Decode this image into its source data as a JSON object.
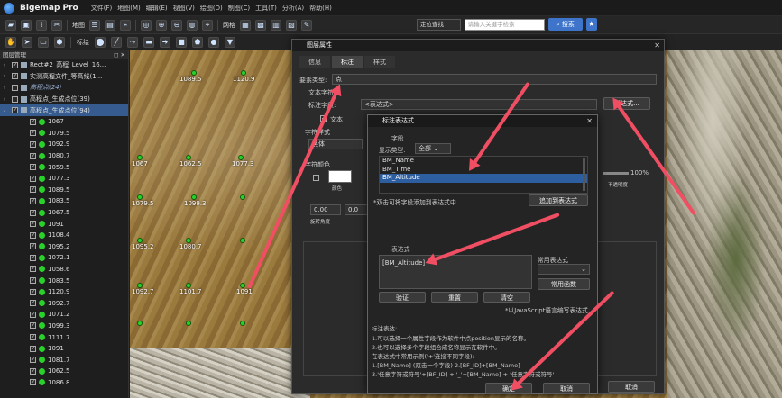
{
  "app": {
    "title": "Bigemap Pro",
    "menu": [
      "文件(F)",
      "地图(M)",
      "编辑(E)",
      "视图(V)",
      "绘图(D)",
      "制图(C)",
      "工具(T)",
      "分析(A)",
      "帮助(H)"
    ]
  },
  "toolbar": {
    "map_label": "地图",
    "grid_label": "网格",
    "measure_label": "标绘",
    "search_mode": "定位查找",
    "search_placeholder": "请输入关键字检索",
    "search_button": "搜索"
  },
  "layer_panel": {
    "header": "图层管理",
    "items": [
      {
        "label": "Rect#2_高程_Level_16...",
        "selected": false,
        "italic": false
      },
      {
        "label": "实测高程文件_等高线(1...",
        "selected": false,
        "italic": false
      },
      {
        "label": "高程点(24)",
        "selected": false,
        "italic": true
      },
      {
        "label": "高程点_生成点位(39)",
        "selected": false,
        "italic": false
      },
      {
        "label": "高程点_生成点位(94)",
        "selected": true,
        "italic": false
      }
    ],
    "values": [
      "1067",
      "1079.5",
      "1092.9",
      "1080.7",
      "1059.5",
      "1077.3",
      "1089.5",
      "1083.5",
      "1067.5",
      "1091",
      "1108.4",
      "1095.2",
      "1072.1",
      "1058.6",
      "1083.5",
      "1120.9",
      "1092.7",
      "1071.2",
      "1099.3",
      "1111.7",
      "1091",
      "1081.7",
      "1062.5",
      "1086.8"
    ]
  },
  "map_labels": [
    "1089.5",
    "1120.9",
    "1067",
    "1062.5",
    "1077.3",
    "1079.5",
    "1099.3",
    "1095.2",
    "1080.7",
    "1092.7",
    "1101.7",
    "1091"
  ],
  "layer_props": {
    "title": "图层属性",
    "tabs": [
      "信息",
      "标注",
      "样式"
    ],
    "element_type_label": "要素类型:",
    "element_type_value": "点",
    "section_text_string": "文本字符串",
    "label_field_label": "标注字段:",
    "label_field_value": "<表达式>",
    "expression_button": "表达式...",
    "text_checkbox": "文本",
    "section_font_style": "字符样式",
    "font_value": "黑体",
    "font_color_label": "字符颜色",
    "opacity_value": "100%",
    "opacity_caption": "不透明度",
    "color_caption": "颜色",
    "rotation_value": "0.00",
    "rotation_caption": "旋转角度",
    "offset_value": "0.0",
    "ok_button": "确定",
    "cancel_button": "取消"
  },
  "expression_dialog": {
    "title": "标注表达式",
    "section_fields": "字段",
    "display_type_label": "显示类型:",
    "display_type_value": "全部",
    "fields": [
      "BM_Name",
      "BM_Time",
      "BM_Altitude"
    ],
    "selected_field": "BM_Altitude",
    "double_click_hint": "*双击可将字段添加到表达式中",
    "add_button": "追加到表达式",
    "section_expression": "表达式",
    "expression_value": "[BM_Altitude]",
    "common_expr_label": "常用表达式",
    "common_func_button": "常用函数",
    "verify_button": "验证",
    "reset_button": "重置",
    "clear_button": "清空",
    "js_hint": "*以JavaScript语言编写表达式",
    "help_title": "标注表达:",
    "help_lines": [
      "1.可以选择一个属性字段作为软件中点position显示的名称。",
      "2.也可以选择多个字段组合成名称显示在软件中。",
      "在表达式中常用示例('+'连接不同字段):",
      "1.[BM_Name]  (双击一个字段)        2.[BF_ID]+[BM_Name]",
      "3.'任意字符或符号'+[BF_ID] + '_'+[BM_Name] + '任意字符或符号'"
    ],
    "ok_button": "确定",
    "cancel_button": "取消"
  },
  "colors": {
    "accent": "#3e74c9",
    "arrow": "#f04f63",
    "selection": "#2d5fa0",
    "point": "#2bd12b"
  }
}
